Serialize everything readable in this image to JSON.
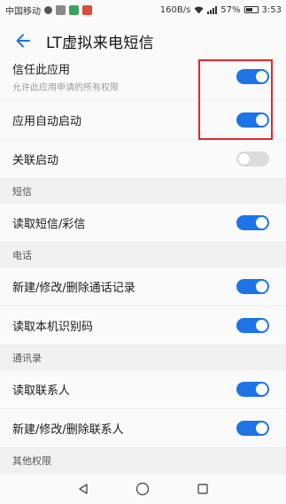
{
  "status_bar": {
    "carrier": "中国移动",
    "speed": "160B/s",
    "battery": "57%",
    "time": "3:53"
  },
  "header": {
    "title": "LT虚拟来电短信",
    "back_icon": "arrow-left-icon"
  },
  "settings": {
    "trust": {
      "label": "信任此应用",
      "sublabel": "允许此应用申请的所有权限",
      "enabled": true
    },
    "autostart": {
      "label": "应用自动启动",
      "enabled": true
    },
    "linked_start": {
      "label": "关联启动",
      "enabled": false
    }
  },
  "sections": {
    "sms": {
      "title": "短信",
      "items": [
        {
          "label": "读取短信/彩信",
          "enabled": true
        }
      ]
    },
    "phone": {
      "title": "电话",
      "items": [
        {
          "label": "新建/修改/删除通话记录",
          "enabled": true
        },
        {
          "label": "读取本机识别码",
          "enabled": true
        }
      ]
    },
    "contacts": {
      "title": "通讯录",
      "items": [
        {
          "label": "读取联系人",
          "enabled": true
        },
        {
          "label": "新建/修改/删除联系人",
          "enabled": true
        }
      ]
    },
    "other": {
      "title": "其他权限"
    }
  },
  "colors": {
    "toggle_on": "#1e74e6",
    "toggle_off": "#dcdcdc",
    "highlight": "#e8262d"
  },
  "nav": {
    "back": "triangle-back-icon",
    "home": "circle-home-icon",
    "recents": "square-recents-icon"
  }
}
